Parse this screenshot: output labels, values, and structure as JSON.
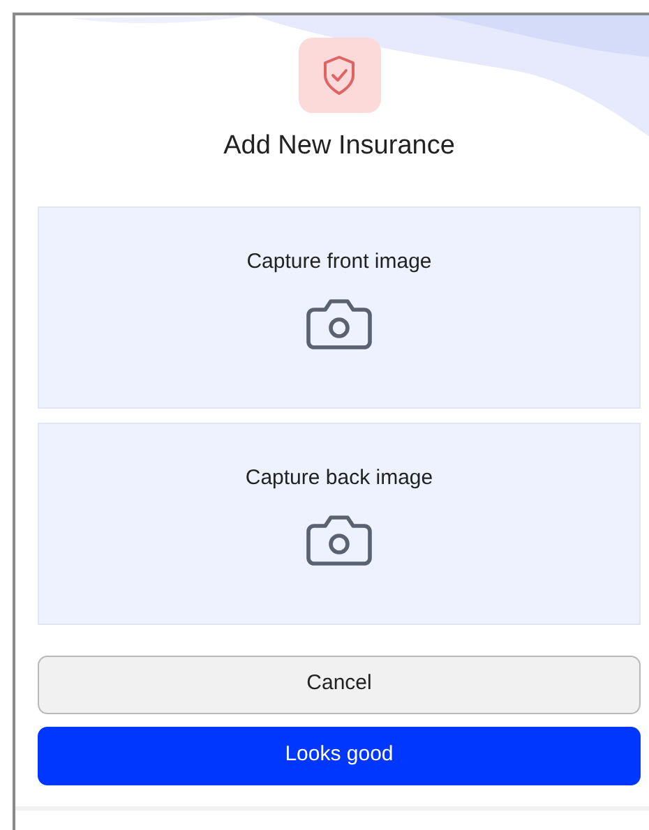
{
  "title": "Add New Insurance",
  "capture_areas": [
    {
      "label": "Capture front image"
    },
    {
      "label": "Capture back image"
    }
  ],
  "buttons": [
    {
      "label": "Cancel",
      "kind": "secondary"
    },
    {
      "label": "Looks good",
      "kind": "primary"
    }
  ]
}
